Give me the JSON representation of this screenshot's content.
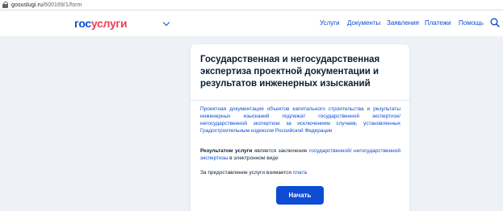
{
  "browser": {
    "url_host": "gosuslugi.ru",
    "url_path": "/600169/1/form"
  },
  "header": {
    "logo_part1": "гос",
    "logo_part2": "услуги",
    "nav": [
      "Услуги",
      "Документы",
      "Заявления",
      "Платежи",
      "Помощь"
    ]
  },
  "card": {
    "title": "Государственная и негосударственная экспертиза проектной документации и результатов инженерных изысканий",
    "description": "Проектная документация объектов капитального строительства и результаты инженерных изысканий подлежат государственной экспертизе/негосударственной экспертизе за исключением случаев, установленных Градостроительным кодексом Российской Федерации",
    "result_label": "Результатом услуги",
    "result_text_1": " является заключение ",
    "result_link": "государственной/ негосударственной экспертизы",
    "result_text_2": " в электронном виде",
    "fee_text": "За предоставление услуги взимается ",
    "fee_link": "плата",
    "start_button": "Начать"
  },
  "colors": {
    "brand_blue": "#0d4cd3",
    "brand_red": "#ee3f58",
    "page_background": "#eef2f6"
  }
}
